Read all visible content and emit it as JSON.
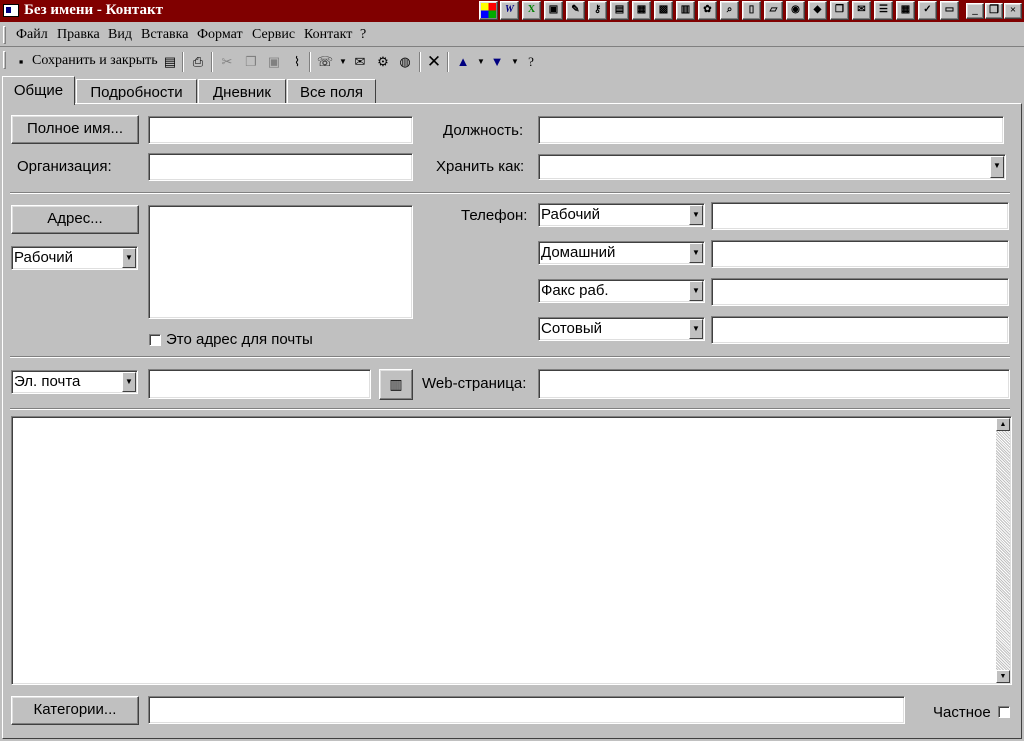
{
  "window": {
    "title": "Без имени - Контакт",
    "title_bg": "#800000"
  },
  "menu": [
    "Файл",
    "Правка",
    "Вид",
    "Вставка",
    "Формат",
    "Сервис",
    "Контакт",
    "?"
  ],
  "toolbar": {
    "save_close_label": "Сохранить и закрыть"
  },
  "tabs": [
    "Общие",
    "Подробности",
    "Дневник",
    "Все поля"
  ],
  "form": {
    "full_name_button": "Полное имя...",
    "full_name_value": "",
    "organization_label": "Организация:",
    "organization_value": "",
    "job_title_label": "Должность:",
    "job_title_value": "",
    "file_as_label": "Хранить как:",
    "file_as_value": "",
    "address_button": "Адрес...",
    "address_type": "Рабочий",
    "address_value": "",
    "mailing_address_label": "Это адрес для почты",
    "phone_label": "Телефон:",
    "phones": [
      {
        "type": "Рабочий",
        "value": ""
      },
      {
        "type": "Домашний",
        "value": ""
      },
      {
        "type": "Факс раб.",
        "value": ""
      },
      {
        "type": "Сотовый",
        "value": ""
      }
    ],
    "email_type": "Эл. почта",
    "email_value": "",
    "web_label": "Web-страница:",
    "web_value": "",
    "notes_value": "",
    "categories_button": "Категории...",
    "categories_value": "",
    "private_label": "Частное"
  }
}
